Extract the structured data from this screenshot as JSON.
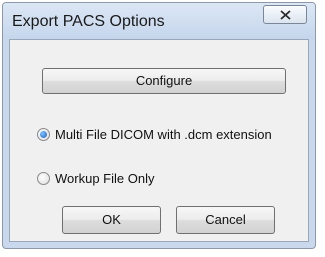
{
  "window": {
    "title": "Export PACS Options"
  },
  "dialog": {
    "configure_label": "Configure",
    "options": [
      {
        "label": "Multi File DICOM with .dcm extension",
        "selected": true
      },
      {
        "label": "Workup File Only",
        "selected": false
      }
    ],
    "ok_label": "OK",
    "cancel_label": "Cancel"
  },
  "icons": {
    "close": "close-x-icon"
  },
  "colors": {
    "titlebar": "#c9d8ec",
    "client_background": "#f0f0f0",
    "radio_selected": "#1f5fbf"
  }
}
